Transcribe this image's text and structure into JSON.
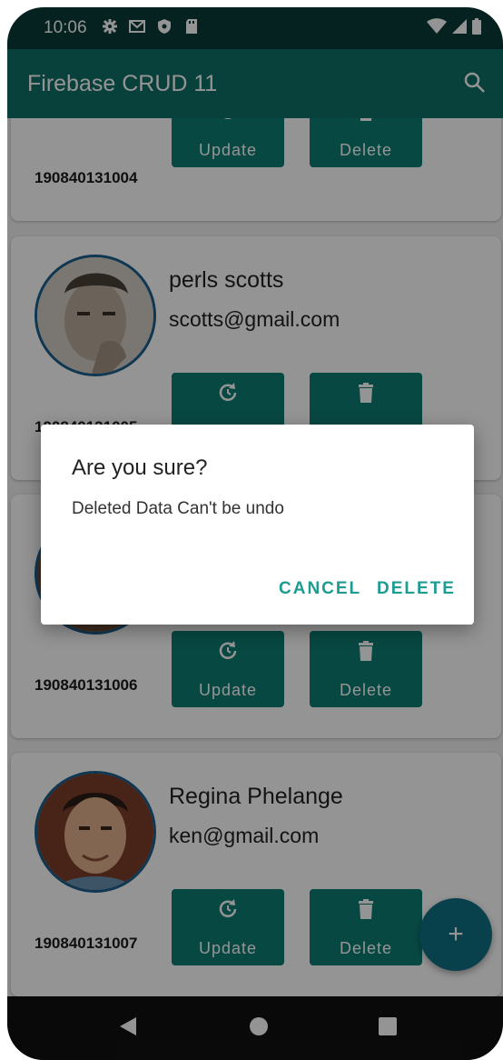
{
  "status_bar": {
    "time": "10:06"
  },
  "app_bar": {
    "title": "Firebase CRUD 11"
  },
  "buttons": {
    "update_label": "Update",
    "delete_label": "Delete"
  },
  "records": [
    {
      "roll": "190840131004",
      "name": "",
      "email": ""
    },
    {
      "roll": "190840131005",
      "name": "perls scotts",
      "email": "scotts@gmail.com"
    },
    {
      "roll": "190840131006",
      "name": "",
      "email": ""
    },
    {
      "roll": "190840131007",
      "name": "Regina Phelange",
      "email": "ken@gmail.com"
    }
  ],
  "dialog": {
    "title": "Are you sure?",
    "message": "Deleted Data Can't be undo",
    "cancel_label": "CANCEL",
    "delete_label": "DELETE"
  },
  "fab": {
    "icon": "plus-icon"
  },
  "colors": {
    "primary": "#0e6f68",
    "status_bar": "#0a3b3a",
    "button": "#0f7d73",
    "fab": "#0f6f84",
    "dialog_action": "#1c9c93"
  }
}
